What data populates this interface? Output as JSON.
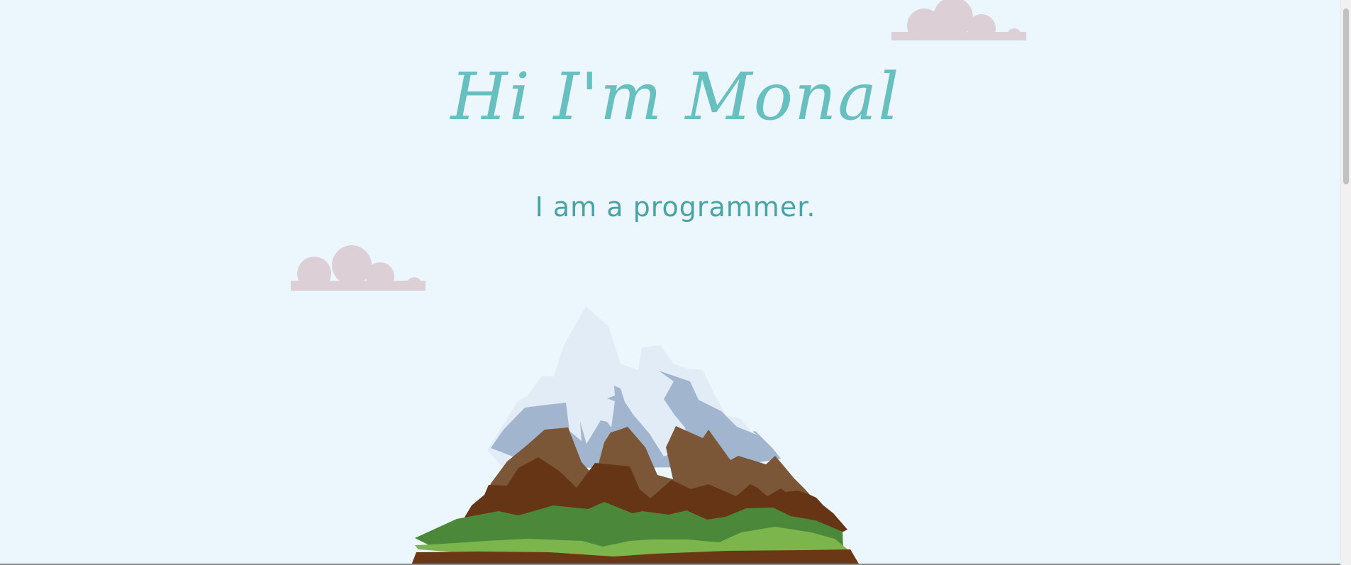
{
  "hero": {
    "title": "Hi I'm Monal",
    "subtitle": "I am a programmer."
  },
  "scene": {
    "icons": [
      "cloud-icon",
      "cloud-icon",
      "mountain-illustration"
    ],
    "colors": {
      "background": "#ecf7fd",
      "title": "#67bfc0",
      "subtitle": "#4aa2a4",
      "cloud": "#dccfd5",
      "snow_light": "#e1ecf7",
      "snow_shadow": "#a2b5ce",
      "rock": "#7b5738",
      "rock_dark": "#663516",
      "grass_dark": "#4b883a",
      "grass_light": "#7bb54c",
      "soil": "#6b3816"
    }
  }
}
